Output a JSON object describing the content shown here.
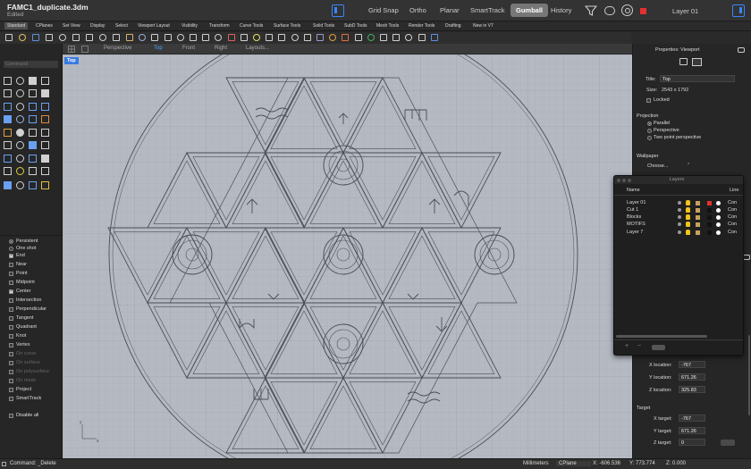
{
  "window": {
    "title": "FAMC1_duplicate.3dm",
    "subtitle": "Edited"
  },
  "titlebar": {
    "toggles": [
      "Grid Snap",
      "Ortho",
      "Planar",
      "SmartTrack",
      "Gumball",
      "History"
    ],
    "active_toggle": "Gumball",
    "current_layer": "Layer 01",
    "layer_color": "#e53030"
  },
  "tabs": [
    "Standard",
    "CPlanes",
    "Set View",
    "Display",
    "Select",
    "Viewport Layout",
    "Visibility",
    "Transform",
    "Curve Tools",
    "Surface Tools",
    "Solid Tools",
    "SubD Tools",
    "Mesh Tools",
    "Render Tools",
    "Drafting",
    "New in V7"
  ],
  "command": {
    "placeholder": "Command"
  },
  "osnaps": [
    {
      "label": "Persistent",
      "kind": "radio",
      "checked": true,
      "enabled": true
    },
    {
      "label": "One shot",
      "kind": "radio",
      "checked": false,
      "enabled": true
    },
    {
      "label": "End",
      "kind": "check",
      "checked": true,
      "enabled": true
    },
    {
      "label": "Near",
      "kind": "check",
      "checked": false,
      "enabled": true
    },
    {
      "label": "Point",
      "kind": "check",
      "checked": false,
      "enabled": true
    },
    {
      "label": "Midpoint",
      "kind": "check",
      "checked": false,
      "enabled": true
    },
    {
      "label": "Center",
      "kind": "check",
      "checked": true,
      "enabled": true
    },
    {
      "label": "Intersection",
      "kind": "check",
      "checked": false,
      "enabled": true
    },
    {
      "label": "Perpendicular",
      "kind": "check",
      "checked": false,
      "enabled": true
    },
    {
      "label": "Tangent",
      "kind": "check",
      "checked": false,
      "enabled": true
    },
    {
      "label": "Quadrant",
      "kind": "check",
      "checked": false,
      "enabled": true
    },
    {
      "label": "Knot",
      "kind": "check",
      "checked": false,
      "enabled": true
    },
    {
      "label": "Vertex",
      "kind": "check",
      "checked": false,
      "enabled": true
    },
    {
      "label": "On curve",
      "kind": "check",
      "checked": false,
      "enabled": false
    },
    {
      "label": "On surface",
      "kind": "check",
      "checked": false,
      "enabled": false
    },
    {
      "label": "On polysurface",
      "kind": "check",
      "checked": false,
      "enabled": false
    },
    {
      "label": "On mesh",
      "kind": "check",
      "checked": false,
      "enabled": false
    },
    {
      "label": "Project",
      "kind": "check",
      "checked": false,
      "enabled": true
    },
    {
      "label": "SmartTrack",
      "kind": "check",
      "checked": false,
      "enabled": true
    },
    {
      "label": "Disable all",
      "kind": "check",
      "checked": false,
      "enabled": true
    }
  ],
  "viewport": {
    "tabs": [
      "Perspective",
      "Top",
      "Front",
      "Right",
      "Layouts..."
    ],
    "active_tab": "Top",
    "label": "Top"
  },
  "properties": {
    "header": "Properties: Viewport",
    "title_label": "Title:",
    "title_value": "Top",
    "size_label": "Size:",
    "size_value": "2543 x 1792",
    "locked_label": "Locked",
    "projection_header": "Projection",
    "projection_options": [
      "Parallel",
      "Perspective",
      "Two point perspective"
    ],
    "projection_selected": "Parallel",
    "wallpaper_header": "Wallpaper",
    "wallpaper_choose": "Choose...",
    "x_location_label": "X location:",
    "x_location": "-767",
    "y_location_label": "Y location:",
    "y_location": "671.26",
    "z_location_label": "Z location:",
    "z_location": "325.83",
    "target_header": "Target",
    "x_target_label": "X target:",
    "x_target": "-767",
    "y_target_label": "Y target:",
    "y_target": "671.26",
    "z_target_label": "Z target:",
    "z_target": "0"
  },
  "layers": {
    "title": "Layers",
    "header_name": "Name",
    "header_line": "Line",
    "rows": [
      {
        "name": "Layer 01",
        "color": "#e53030",
        "line": "Con"
      },
      {
        "name": "Cut 1",
        "color": "#111111",
        "line": "Con"
      },
      {
        "name": "Blocks",
        "color": "#111111",
        "line": "Con"
      },
      {
        "name": "MOTIFS",
        "color": "#111111",
        "line": "Con"
      },
      {
        "name": "Layer 7",
        "color": "#111111",
        "line": "Con"
      }
    ]
  },
  "status": {
    "command_history": "Command: _Delete",
    "units": "Millimeters",
    "cplane": "CPlane",
    "x": "X: -606.536",
    "y": "Y: 773.774",
    "z": "Z: 0.000"
  },
  "accent_color": "#3a86ff"
}
